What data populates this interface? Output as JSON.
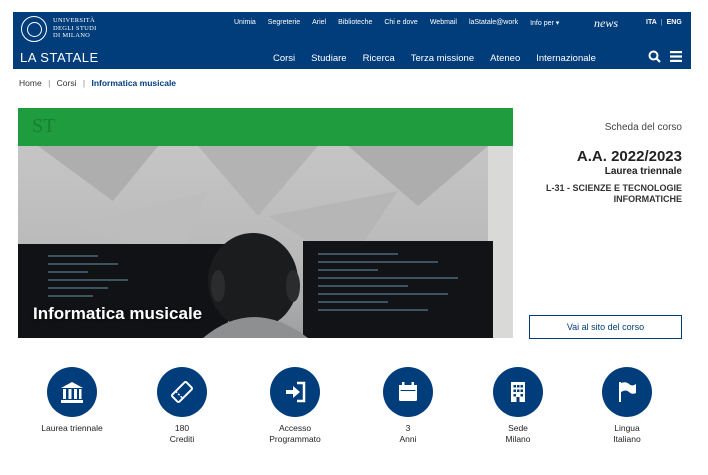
{
  "header": {
    "university_lines": [
      "UNIVERSITÀ",
      "DEGLI STUDI",
      "DI MILANO"
    ],
    "brand": "LA STATALE",
    "top_links": [
      "Unimia",
      "Segreterie",
      "Ariel",
      "Biblioteche",
      "Chi e dove",
      "Webmail",
      "laStatale@work",
      "Info per ▾"
    ],
    "news_label": "news",
    "lang_ita": "ITA",
    "lang_separator": "|",
    "lang_eng": "ENG",
    "main_nav": [
      "Corsi",
      "Studiare",
      "Ricerca",
      "Terza missione",
      "Ateneo",
      "Internazionale"
    ]
  },
  "breadcrumb": {
    "home": "Home",
    "section": "Corsi",
    "current": "Informatica musicale",
    "separator": "|"
  },
  "hero": {
    "band_text": "ST",
    "title": "Informatica musicale"
  },
  "course": {
    "scheda_label": "Scheda del corso",
    "year": "A.A. 2022/2023",
    "level": "Laurea triennale",
    "classe": "L-31 - SCIENZE E TECNOLOGIE INFORMATICHE",
    "site_button": "Vai al sito del corso"
  },
  "features": [
    {
      "icon": "institution-icon",
      "line1": "Laurea triennale",
      "line2": ""
    },
    {
      "icon": "ticket-icon",
      "line1": "180",
      "line2": "Crediti"
    },
    {
      "icon": "sign-in-icon",
      "line1": "Accesso",
      "line2": "Programmato"
    },
    {
      "icon": "calendar-icon",
      "line1": "3",
      "line2": "Anni"
    },
    {
      "icon": "building-icon",
      "line1": "Sede",
      "line2": "Milano"
    },
    {
      "icon": "flag-icon",
      "line1": "Lingua",
      "line2": "Italiano"
    }
  ],
  "colors": {
    "brand_blue": "#003d7a",
    "band_green": "#1f9c3e"
  }
}
